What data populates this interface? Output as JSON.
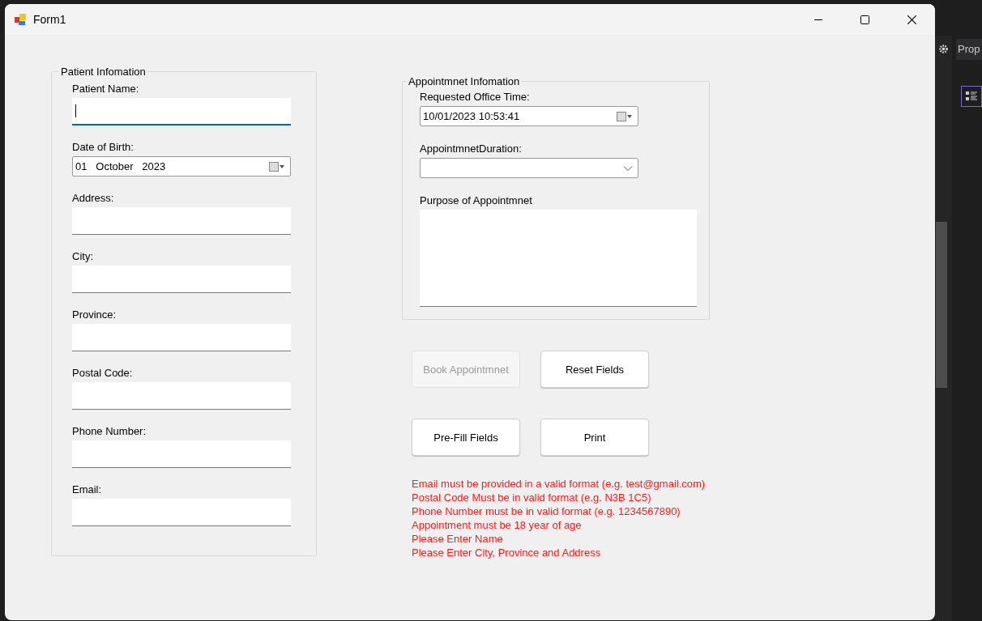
{
  "ide": {
    "panel_tab": "Prop"
  },
  "window": {
    "title": "Form1"
  },
  "patient_info": {
    "title": "Patient Infomation",
    "fields": [
      {
        "kind": "text",
        "label": "Patient Name:",
        "focused": true
      },
      {
        "kind": "date",
        "label": "Date of Birth:",
        "value": "01   October   2023"
      },
      {
        "kind": "text",
        "label": "Address:",
        "focused": false
      },
      {
        "kind": "text",
        "label": "City:",
        "focused": false
      },
      {
        "kind": "text",
        "label": "Province:",
        "focused": false
      },
      {
        "kind": "text",
        "label": "Postal Code:",
        "focused": false
      },
      {
        "kind": "text",
        "label": "Phone Number:",
        "focused": false
      },
      {
        "kind": "text",
        "label": "Email:",
        "focused": false
      }
    ]
  },
  "appointment_info": {
    "title": "Appointmnet Infomation",
    "fields": [
      {
        "kind": "date",
        "label": "Requested Office Time:",
        "value": "10/01/2023 10:53:41"
      },
      {
        "kind": "combo",
        "label": "AppointmnetDuration:"
      },
      {
        "kind": "memo",
        "label": "Purpose of Appointmnet"
      }
    ]
  },
  "buttons": [
    {
      "label": "Book Appointmnet",
      "disabled": true
    },
    {
      "label": "Reset Fields",
      "disabled": false
    },
    {
      "label": "Pre-Fill Fields",
      "disabled": false
    },
    {
      "label": "Print",
      "disabled": false
    }
  ],
  "errors": [
    "Email must be provided in a valid format (e.g. test@gmail.com)",
    "Postal Code Must be in valid format (e.g. N3B 1C5)",
    "Phone Number must be in valid format (e.g. 1234567890)",
    "Appointment must be 18 year of age",
    "Please Enter Name",
    "Please Enter City, Province and Address"
  ]
}
